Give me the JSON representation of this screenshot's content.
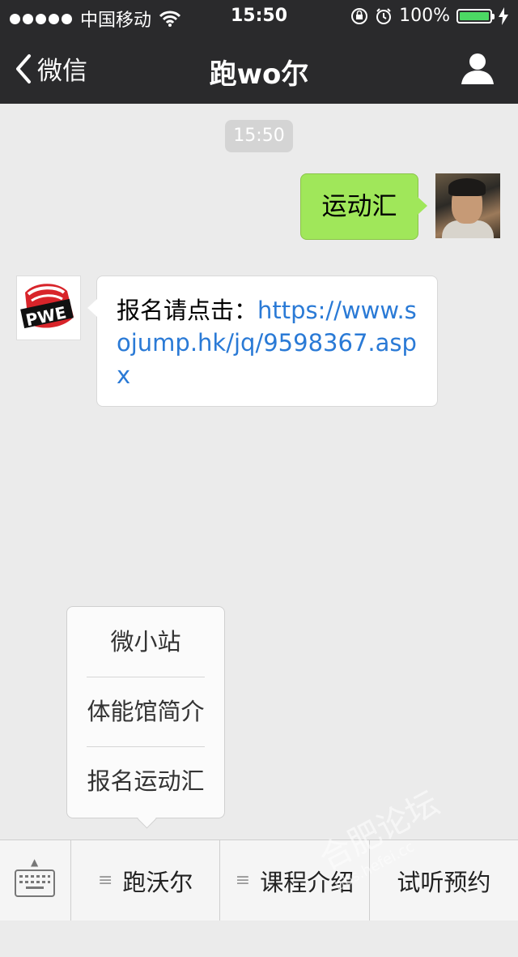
{
  "status_bar": {
    "carrier": "中国移动",
    "time": "15:50",
    "battery": "100%"
  },
  "nav": {
    "back_label": "微信",
    "title": "跑wo尔"
  },
  "chat": {
    "timestamp": "15:50",
    "messages": [
      {
        "from": "self",
        "text": "运动汇"
      },
      {
        "from": "bot",
        "text_prefix": "报名请点击：",
        "link": "https://www.sojump.hk/jq/9598367.aspx"
      }
    ],
    "bot_avatar_text": "PWE"
  },
  "popup_menu": {
    "items": [
      "微小站",
      "体能馆简介",
      "报名运动汇"
    ]
  },
  "bottom_menu": {
    "tabs": [
      "跑沃尔",
      "课程介绍",
      "试听预约"
    ]
  },
  "watermark": "合肥论坛",
  "watermark_url": "bbs.hefei.cc",
  "colors": {
    "bar_bg": "#2a2a2c",
    "chat_bg": "#ebebeb",
    "self_bubble": "#a0e75a",
    "link": "#2a7ad6",
    "battery": "#4cd964"
  }
}
